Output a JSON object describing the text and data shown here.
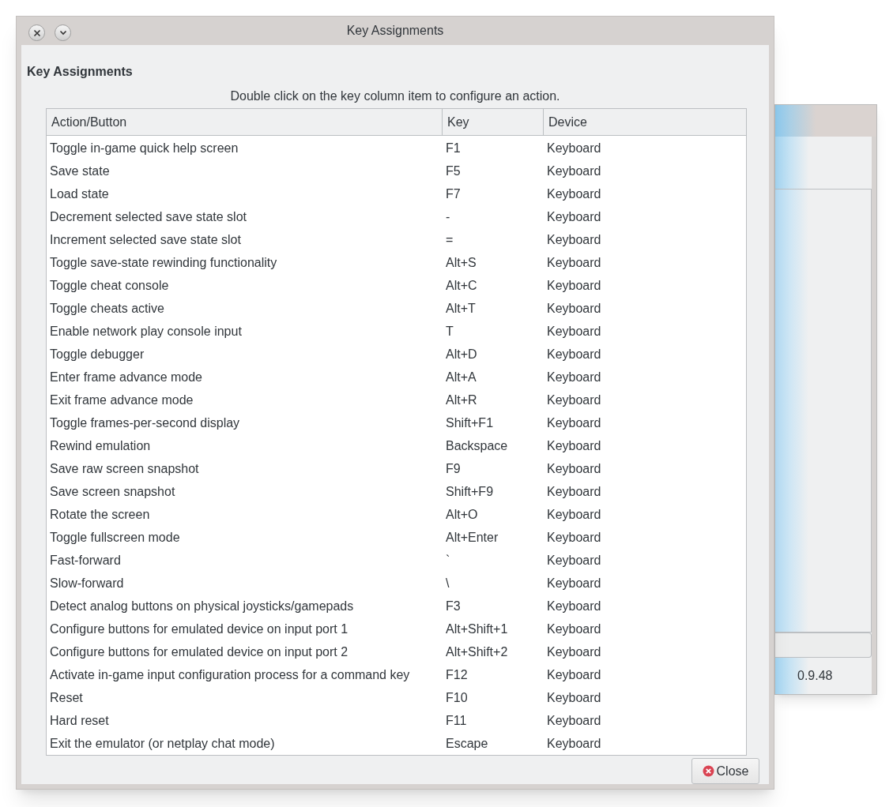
{
  "background_window": {
    "status_text": "0.9.48"
  },
  "window": {
    "title": "Key Assignments"
  },
  "heading": "Key Assignments",
  "instruction": "Double click on the key column item to configure an action.",
  "table": {
    "columns": [
      "Action/Button",
      "Key",
      "Device"
    ],
    "rows": [
      [
        "Toggle in-game quick help screen",
        "F1",
        "Keyboard"
      ],
      [
        "Save state",
        "F5",
        "Keyboard"
      ],
      [
        "Load state",
        "F7",
        "Keyboard"
      ],
      [
        "Decrement selected save state slot",
        "-",
        "Keyboard"
      ],
      [
        "Increment selected save state slot",
        "=",
        "Keyboard"
      ],
      [
        "Toggle save-state rewinding functionality",
        "Alt+S",
        "Keyboard"
      ],
      [
        "Toggle cheat console",
        "Alt+C",
        "Keyboard"
      ],
      [
        "Toggle cheats active",
        "Alt+T",
        "Keyboard"
      ],
      [
        "Enable network play console input",
        "T",
        "Keyboard"
      ],
      [
        "Toggle debugger",
        "Alt+D",
        "Keyboard"
      ],
      [
        "Enter frame advance mode",
        "Alt+A",
        "Keyboard"
      ],
      [
        "Exit frame advance mode",
        "Alt+R",
        "Keyboard"
      ],
      [
        "Toggle frames-per-second display",
        "Shift+F1",
        "Keyboard"
      ],
      [
        "Rewind emulation",
        "Backspace",
        "Keyboard"
      ],
      [
        "Save raw screen snapshot",
        "F9",
        "Keyboard"
      ],
      [
        "Save screen snapshot",
        "Shift+F9",
        "Keyboard"
      ],
      [
        "Rotate the screen",
        "Alt+O",
        "Keyboard"
      ],
      [
        "Toggle fullscreen mode",
        "Alt+Enter",
        "Keyboard"
      ],
      [
        "Fast-forward",
        "`",
        "Keyboard"
      ],
      [
        "Slow-forward",
        "\\",
        "Keyboard"
      ],
      [
        "Detect analog buttons on physical joysticks/gamepads",
        "F3",
        "Keyboard"
      ],
      [
        "Configure buttons for emulated device on input port 1",
        "Alt+Shift+1",
        "Keyboard"
      ],
      [
        "Configure buttons for emulated device on input port 2",
        "Alt+Shift+2",
        "Keyboard"
      ],
      [
        "Activate in-game input configuration process for a command key",
        "F12",
        "Keyboard"
      ],
      [
        "Reset",
        "F10",
        "Keyboard"
      ],
      [
        "Hard reset",
        "F11",
        "Keyboard"
      ],
      [
        "Exit the emulator (or netplay chat mode)",
        "Escape",
        "Keyboard"
      ]
    ]
  },
  "close_button": "Close"
}
